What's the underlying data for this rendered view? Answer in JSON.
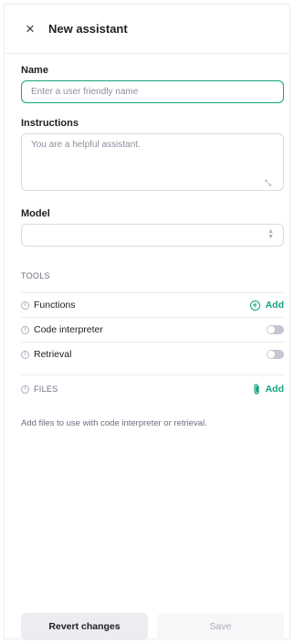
{
  "header": {
    "title": "New assistant"
  },
  "name": {
    "label": "Name",
    "placeholder": "Enter a user friendly name",
    "value": ""
  },
  "instructions": {
    "label": "Instructions",
    "placeholder": "You are a helpful assistant.",
    "value": ""
  },
  "model": {
    "label": "Model",
    "value": ""
  },
  "tools": {
    "heading": "TOOLS",
    "items": [
      {
        "label": "Functions",
        "action": "Add"
      },
      {
        "label": "Code interpreter",
        "enabled": false
      },
      {
        "label": "Retrieval",
        "enabled": false
      }
    ]
  },
  "files": {
    "heading": "FILES",
    "action": "Add",
    "help": "Add files to use with code interpreter or retrieval."
  },
  "footer": {
    "revert_label": "Revert changes",
    "save_label": "Save"
  },
  "colors": {
    "accent": "#10a37f",
    "border": "#ececf1",
    "toggle_off": "#c5c5d2"
  }
}
